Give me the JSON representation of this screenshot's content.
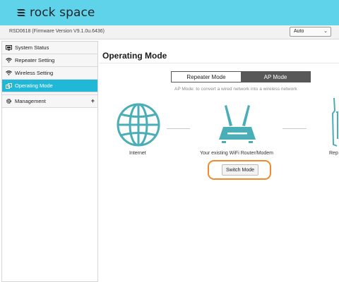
{
  "header": {
    "brand": "rock space",
    "brand_color": "#5fd3ea"
  },
  "infobar": {
    "firmware": "RSD0618 (Firmware Version V9.1.0u.6436)",
    "language_selected": "Auto"
  },
  "sidebar": {
    "items": [
      {
        "label": "System Status",
        "icon": "monitor-icon",
        "active": false
      },
      {
        "label": "Repeater Setting",
        "icon": "wifi-icon",
        "active": false
      },
      {
        "label": "Wireless Setting",
        "icon": "wifi-icon",
        "active": false
      },
      {
        "label": "Operating Mode",
        "icon": "mode-icon",
        "active": true
      },
      {
        "label": "Management",
        "icon": "gear-icon",
        "active": false,
        "expandable": "+"
      }
    ],
    "active_color": "#20b8d6"
  },
  "main": {
    "title": "Operating Mode",
    "tabs": [
      {
        "label": "Repeater Mode",
        "selected": false
      },
      {
        "label": "AP Mode",
        "selected": true
      }
    ],
    "mode_description": "AP Mode: to convert a wired network into a wireless network",
    "diagram": {
      "internet_label": "Internet",
      "router_label": "Your existing WiFi Router/Modem",
      "repeater_label": "Rep",
      "icon_color": "#4aaeb7"
    },
    "switch_button": "Switch Mode",
    "highlight_color": "#f08a2c"
  }
}
